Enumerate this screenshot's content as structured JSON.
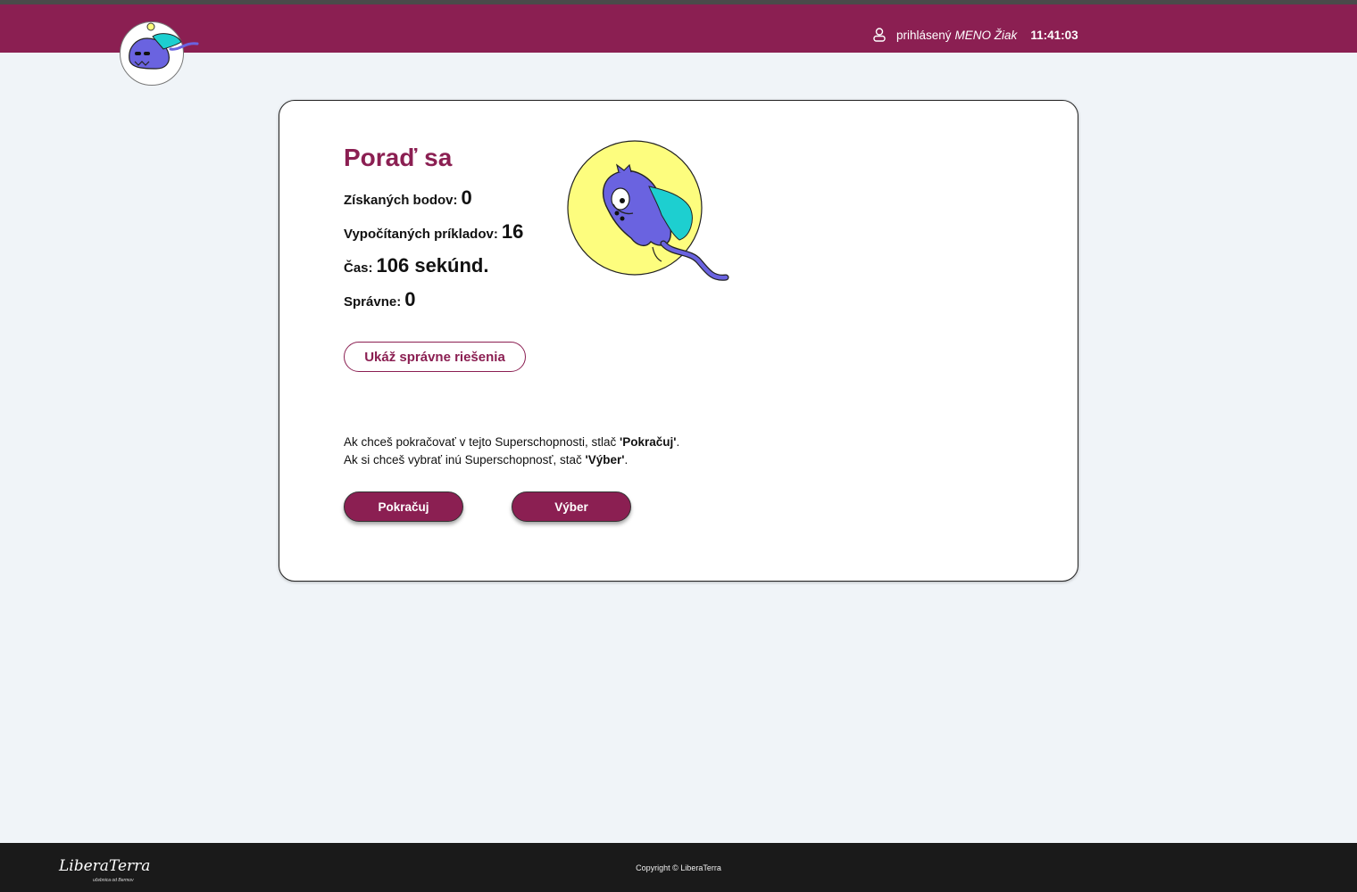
{
  "header": {
    "user_label": "prihlásený",
    "user_name": "MENO Žiak",
    "clock": "11:41:03"
  },
  "result": {
    "title": "Poraď sa",
    "points_label": "Získaných bodov:",
    "points_value": "0",
    "examples_label": "Vypočítaných príkladov:",
    "examples_value": "16",
    "time_label": "Čas:",
    "time_value": "106 sekúnd.",
    "correct_label": "Správne:",
    "correct_value": "0",
    "show_solutions_button": "Ukáž správne riešenia"
  },
  "info": {
    "line1_prefix": "Ak chceš pokračovať v tejto Superschopnosti, stlač",
    "line1_bold": "'Pokračuj'",
    "line1_suffix": ".",
    "line2_prefix": "Ak si chceš vybrať inú Superschopnosť, stač",
    "line2_bold": "'Výber'",
    "line2_suffix": "."
  },
  "actions": {
    "continue_button": "Pokračuj",
    "select_button": "Výber"
  },
  "footer": {
    "logo_text": "LiberaTerra",
    "logo_subtext": "učebnica od Bermov",
    "copyright": "Copyright © LiberaTerra"
  },
  "colors": {
    "brand": "#8b1f52",
    "background": "#f0f4f8",
    "footer": "#1a1a1a",
    "mascot_body": "#6a63e0",
    "mascot_hair": "#1dcfd0",
    "moon": "#fdfd7e"
  },
  "icons": {
    "user": "user-icon",
    "logo": "monster-logo",
    "mascot": "monster-mascot"
  }
}
